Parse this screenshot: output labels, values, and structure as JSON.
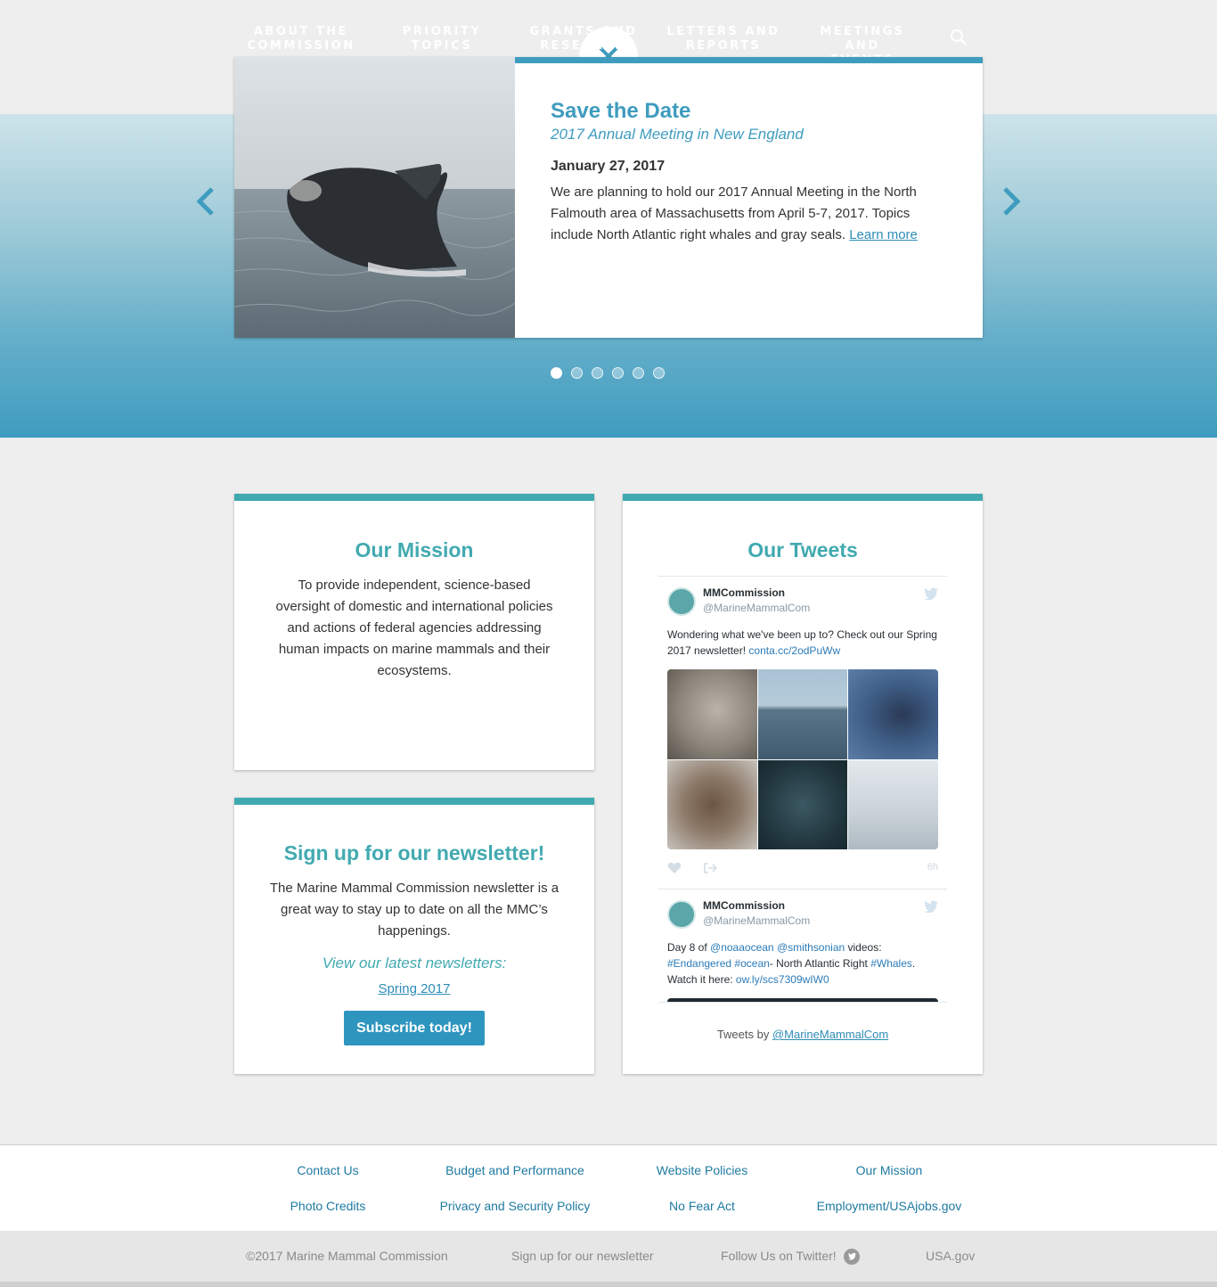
{
  "nav": {
    "items": [
      {
        "line1": "About the",
        "line2": "Commission"
      },
      {
        "line1": "Priority",
        "line2": "Topics"
      },
      {
        "line1": "Grants and",
        "line2": "Research"
      },
      {
        "line1": "Letters and",
        "line2": "Reports"
      },
      {
        "line1": "Meetings and",
        "line2": "Events"
      }
    ],
    "search_icon": "search-icon",
    "close_icon": "close-icon"
  },
  "slider": {
    "title": "Save the Date",
    "subtitle": "2017 Annual Meeting in New England",
    "date": "January 27, 2017",
    "body": "We are planning to hold our 2017 Annual Meeting in the North Falmouth area of Massachusetts from April 5-7, 2017. Topics include North Atlantic right whales and gray seals.",
    "link": "Learn more",
    "dots_total": 6,
    "active_dot": 1
  },
  "mission": {
    "title": "Our Mission",
    "body": "To provide independent, science-based oversight of domestic and international policies and actions of federal agencies addressing human impacts on marine mammals and their ecosystems."
  },
  "newsletter": {
    "title": "Sign up for our newsletter!",
    "body": "The Marine Mammal Commission newsletter is a great way to stay up to date on all the MMC’s happenings.",
    "view_label": "View our latest newsletters:",
    "latest_link": "Spring 2017",
    "button": "Subscribe today!"
  },
  "tweets": {
    "title": "Our Tweets",
    "items": [
      {
        "name": "MMCommission",
        "handle": "@MarineMammalCom",
        "text_plain": "Wondering what we've been up to? Check out our Spring 2017 newsletter! ",
        "text_link": "conta.cc/2odPuWw",
        "time": "6h"
      },
      {
        "name": "MMCommission",
        "handle": "@MarineMammalCom",
        "t1": "Day 8 of ",
        "l1": "@noaaocean",
        "l2": "@smithsonian",
        "t2": " videos:",
        "l3": "#Endangered",
        "l4": "#ocean",
        "t3": "- North Atlantic Right ",
        "l5": "#Whales",
        "t4": ". Watch it here: ",
        "l6": "ow.ly/scs7309wIW0"
      }
    ],
    "footer_prefix": "Tweets by ",
    "footer_link": "@MarineMammalCom"
  },
  "footer": {
    "links": [
      "Contact Us",
      "Budget and Performance",
      "Website Policies",
      "Our Mission",
      "Photo Credits",
      "Privacy and Security Policy",
      "No Fear Act",
      "Employment/USAjobs.gov"
    ],
    "copyright": "©2017 Marine Mammal Commission",
    "signup": "Sign up for our newsletter",
    "follow": "Follow Us on Twitter!",
    "usagov": "USA.gov"
  },
  "colors": {
    "accent": "#41aab0",
    "hero_blue": "#3f9cbf",
    "link": "#2e8cb8"
  }
}
